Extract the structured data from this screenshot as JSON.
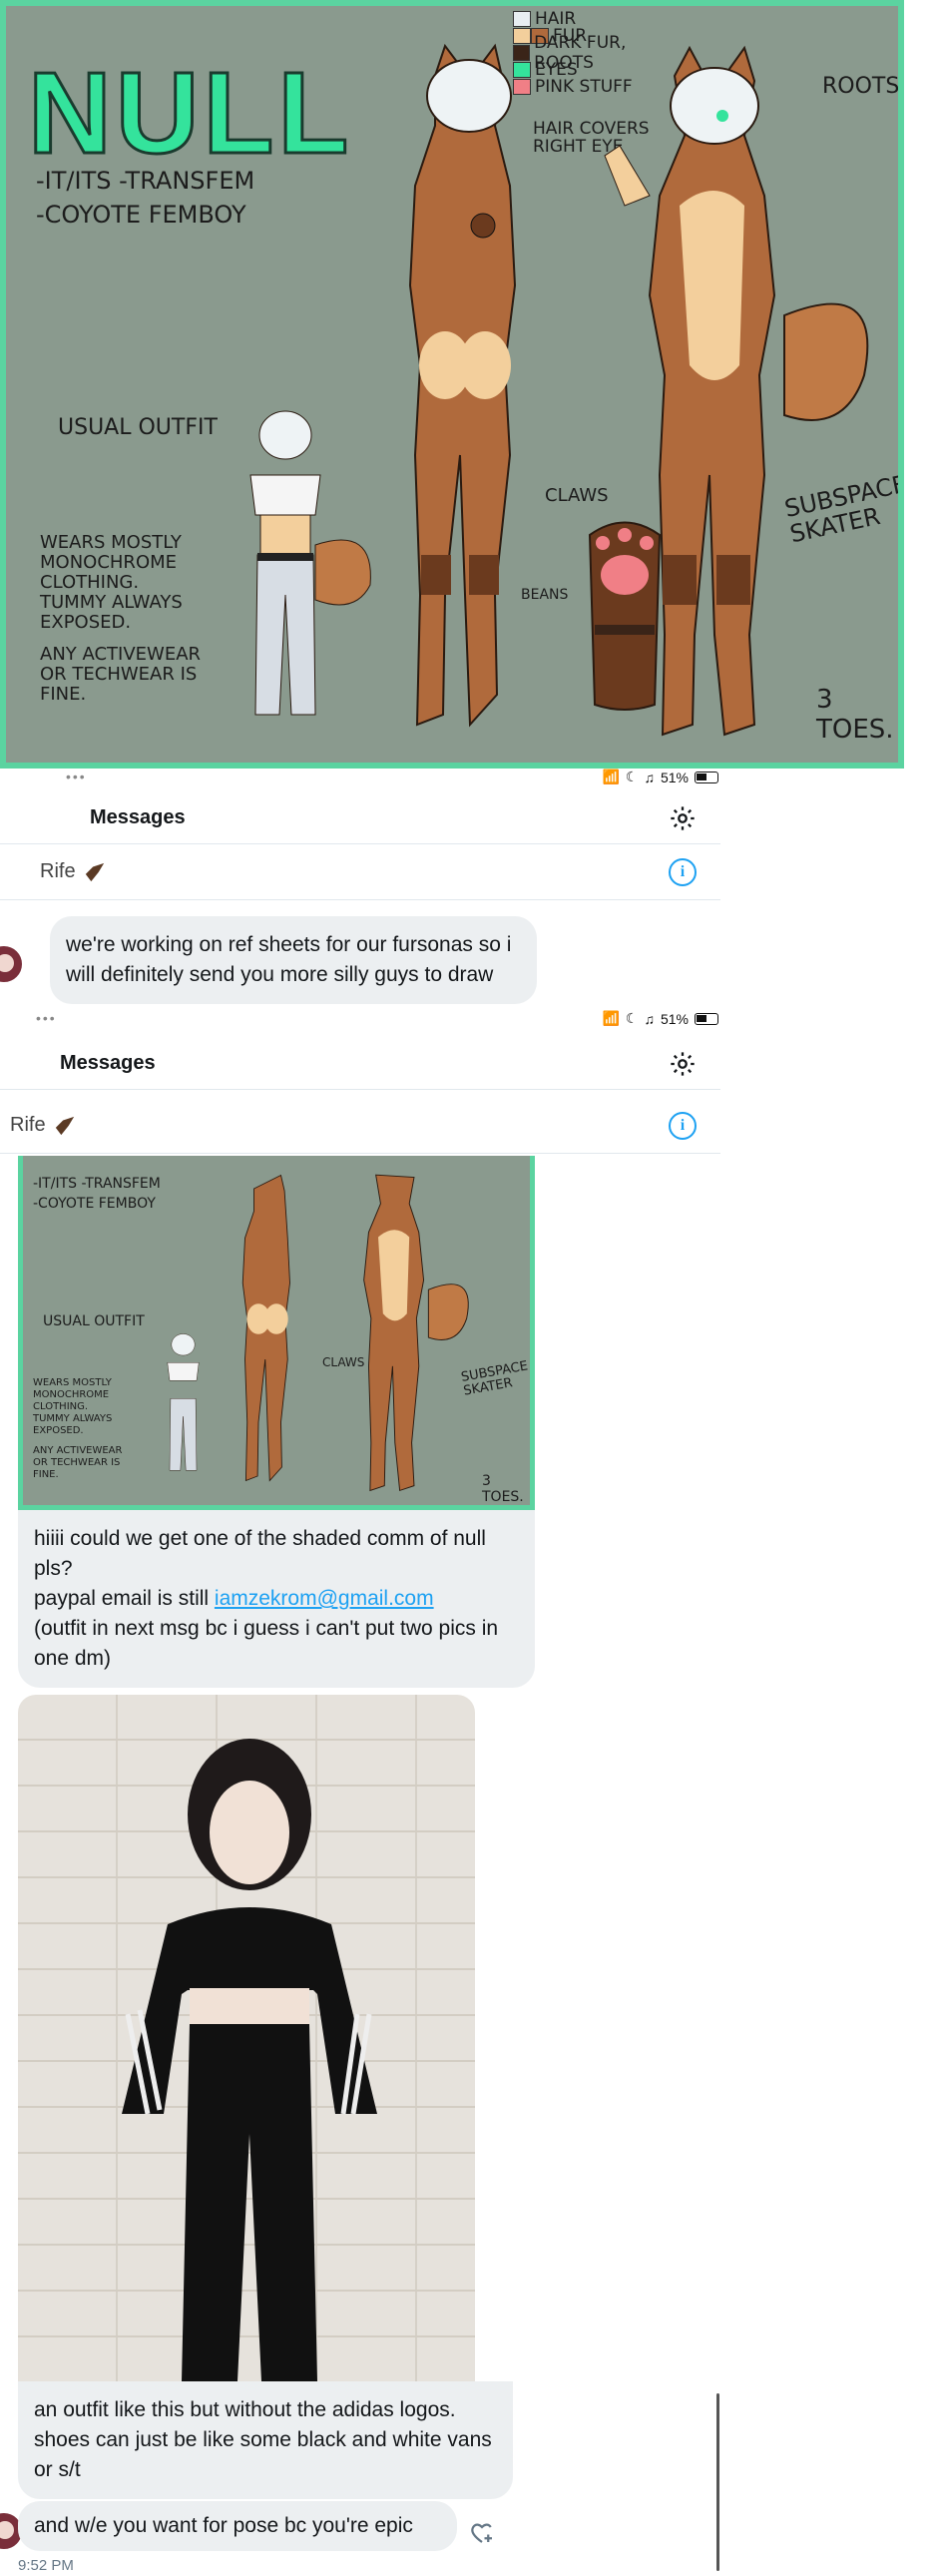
{
  "reference_sheet": {
    "name": "NULL",
    "lines": [
      "-IT/ITS -TRANSFEM",
      "-COYOTE FEMBOY"
    ],
    "legend": [
      {
        "label": "HAIR",
        "colors": [
          "#e8eef2"
        ]
      },
      {
        "label": "FUR",
        "colors": [
          "#f3cf9c",
          "#b06a3c"
        ]
      },
      {
        "label": "DARK FUR, ROOTS",
        "colors": [
          "#3a2418"
        ]
      },
      {
        "label": "EYES",
        "colors": [
          "#34e39c"
        ]
      },
      {
        "label": "PINK STUFF",
        "colors": [
          "#f07f86"
        ]
      }
    ],
    "legend_note": [
      "HAIR COVERS",
      "RIGHT EYE"
    ],
    "roots_label": "ROOTS",
    "outfit_label": "USUAL OUTFIT",
    "outfit_desc": [
      "WEARS MOSTLY",
      "MONOCHROME",
      "CLOTHING.",
      "TUMMY ALWAYS",
      "EXPOSED."
    ],
    "active_desc": [
      "ANY ACTIVEWEAR",
      "OR TECHWEAR IS",
      "FINE."
    ],
    "claws_label": "CLAWS",
    "beans_label": "BEANS",
    "subspace_label": [
      "SUBSPACE",
      "SKATER"
    ],
    "toes_label": "3 TOES."
  },
  "status": {
    "battery": "51%"
  },
  "header": {
    "title": "Messages"
  },
  "conversation": {
    "name": "Rife"
  },
  "messages": {
    "first": "we're working on ref sheets for our fursonas so i will definitely send you more silly guys to draw",
    "second_line1": "hiiii could we get one of the shaded comm of null pls?",
    "second_line2_prefix": "paypal email is still ",
    "second_email": "iamzekrom@gmail.com",
    "second_line3": "(outfit in next msg bc i guess i can't put two pics in one dm)",
    "third": "an outfit like this but without the adidas logos. shoes can just be like some black and white vans or s/t",
    "fourth": "and w/e you want for pose bc you're epic",
    "timestamp": "9:52 PM"
  },
  "colors": {
    "accent": "#1da1f2",
    "sheet_bg": "#8a9a8e",
    "sheet_border": "#5bd3a0",
    "bubble": "#eceff1"
  }
}
